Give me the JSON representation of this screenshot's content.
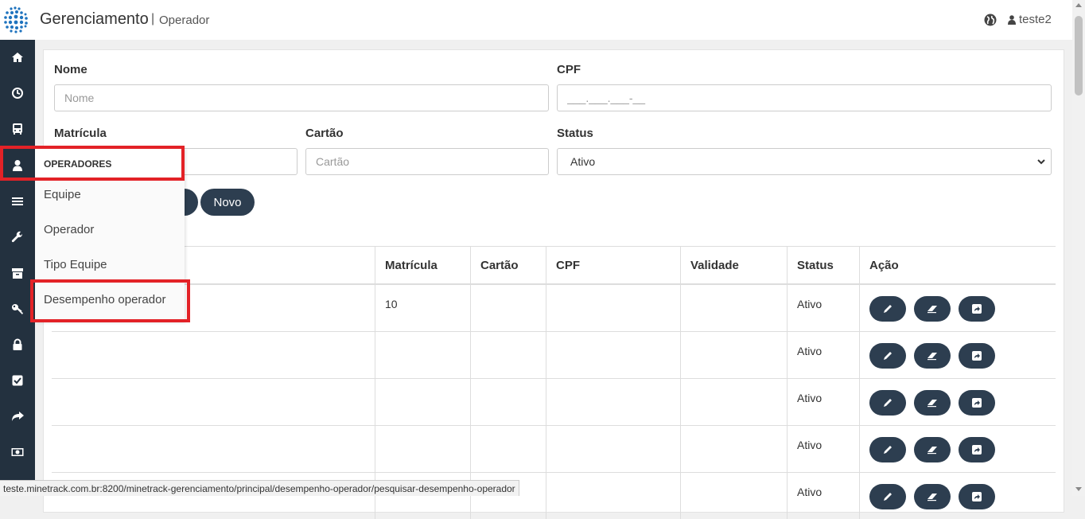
{
  "header": {
    "title": "Gerenciamento",
    "separator": "|",
    "subtitle": "Operador",
    "user": "teste2"
  },
  "form": {
    "nome": {
      "label": "Nome",
      "placeholder": "Nome"
    },
    "cpf": {
      "label": "CPF",
      "placeholder": "___.___.___-__"
    },
    "matricula": {
      "label": "Matrícula"
    },
    "cartao": {
      "label": "Cartão",
      "placeholder": "Cartão"
    },
    "status": {
      "label": "Status",
      "selected": "Ativo"
    },
    "novo_label": "Novo"
  },
  "table": {
    "headers": [
      "Matrícula",
      "Cartão",
      "CPF",
      "Validade",
      "Status",
      "Ação"
    ],
    "rows": [
      {
        "matricula": "10",
        "cartao": "",
        "cpf": "",
        "validade": "",
        "status": "Ativo"
      },
      {
        "matricula": "",
        "cartao": "",
        "cpf": "",
        "validade": "",
        "status": "Ativo"
      },
      {
        "matricula": "",
        "cartao": "",
        "cpf": "",
        "validade": "",
        "status": "Ativo"
      },
      {
        "matricula": "",
        "cartao": "",
        "cpf": "",
        "validade": "",
        "status": "Ativo"
      },
      {
        "matricula": "",
        "cartao": "",
        "cpf": "",
        "validade": "",
        "status": "Ativo"
      }
    ]
  },
  "flyout": {
    "header": "OPERADORES",
    "items": [
      "Equipe",
      "Operador",
      "Tipo Equipe",
      "Desempenho operador"
    ]
  },
  "sidebar_icons": [
    "home-icon",
    "dashboard-icon",
    "bus-icon",
    "user-icon",
    "list-icon",
    "wrench-icon",
    "archive-icon",
    "key-icon",
    "lock-icon",
    "check-square-icon",
    "share-icon",
    "money-icon"
  ],
  "statusbar": {
    "url": "teste.minetrack.com.br:8200/minetrack-gerenciamento/principal/desempenho-operador/pesquisar-desempenho-operador"
  },
  "colors": {
    "sidebar": "#23313f",
    "button": "#2d3e50",
    "highlight": "#e32227"
  }
}
